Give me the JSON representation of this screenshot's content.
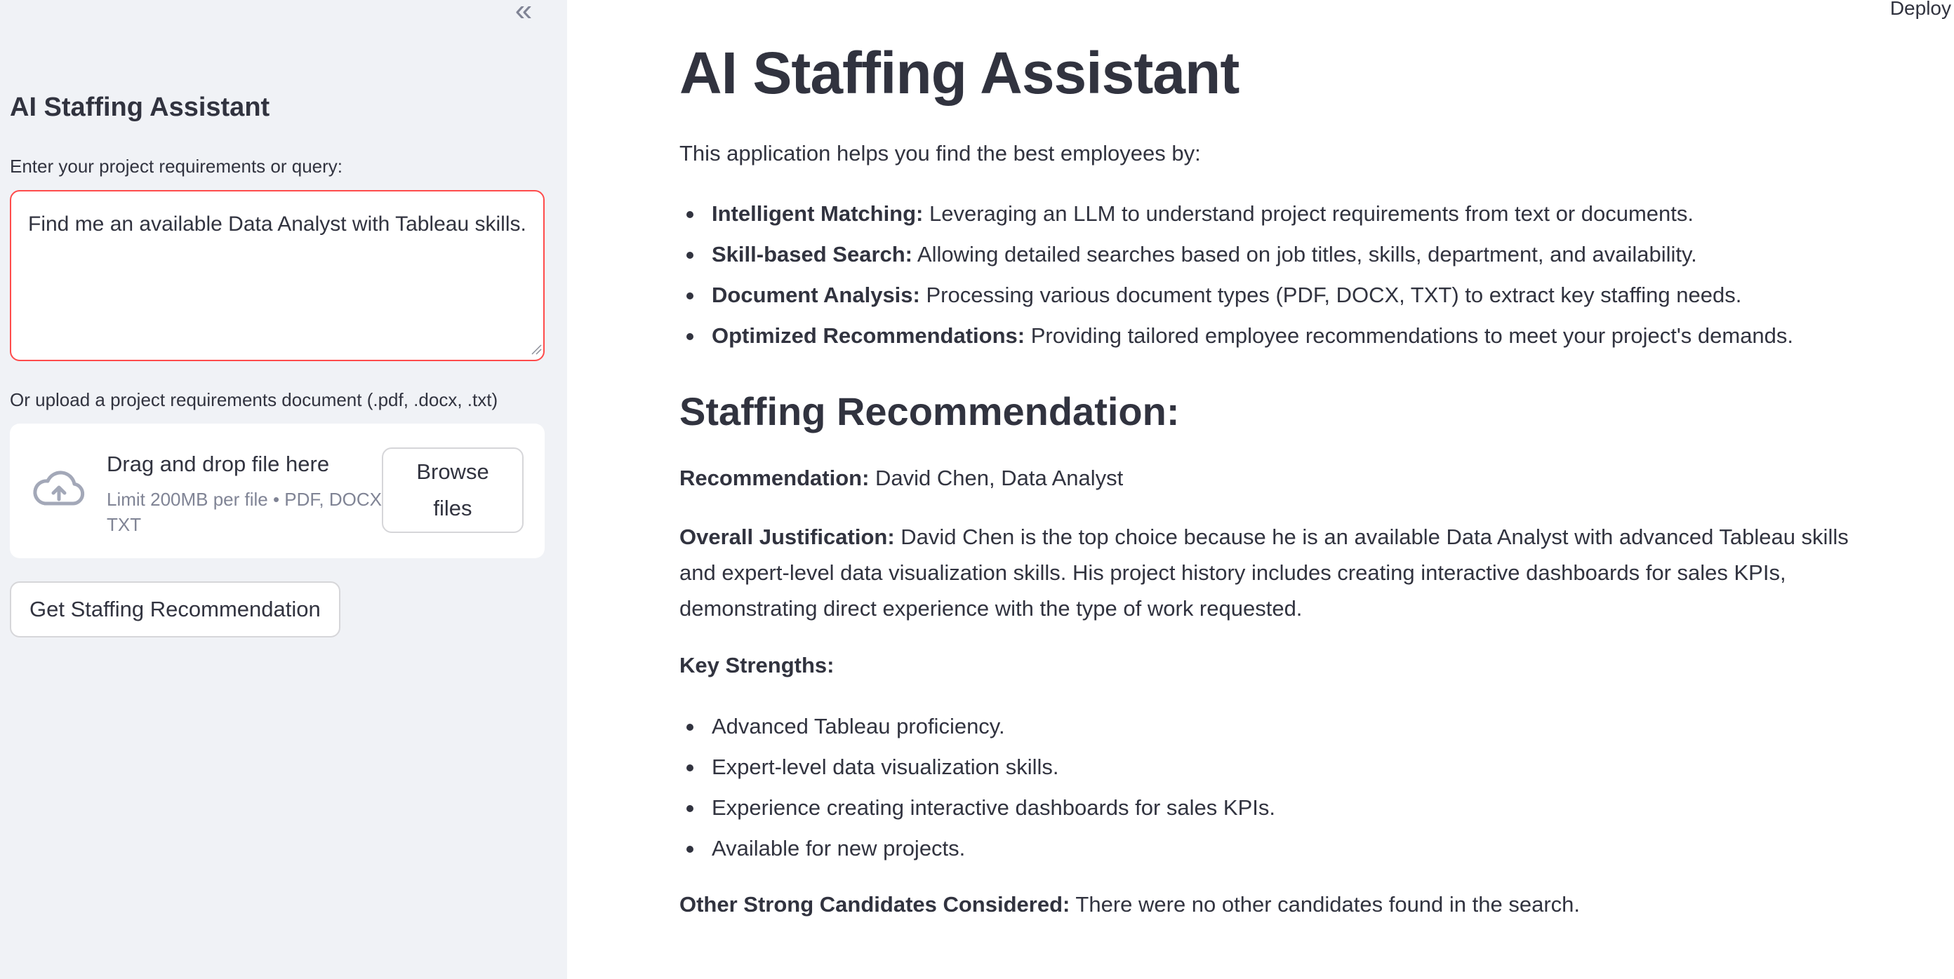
{
  "sidebar": {
    "collapse_glyph": "«",
    "title": "AI Staffing Assistant",
    "query_label": "Enter your project requirements or query:",
    "query_value": "Find me an available Data Analyst with Tableau skills.",
    "upload_label": "Or upload a project requirements document (.pdf, .docx, .txt)",
    "uploader": {
      "drop_text": "Drag and drop file here",
      "limit_text": "Limit 200MB per file • PDF, DOCX, TXT",
      "browse_label": "Browse files",
      "icon": "cloud-upload-icon"
    },
    "submit_label": "Get Staffing Recommendation"
  },
  "header": {
    "deploy_label": "Deploy"
  },
  "main": {
    "title": "AI Staffing Assistant",
    "intro": "This application helps you find the best employees by:",
    "features": [
      {
        "bold": "Intelligent Matching:",
        "text": " Leveraging an LLM to understand project requirements from text or documents."
      },
      {
        "bold": "Skill-based Search:",
        "text": " Allowing detailed searches based on job titles, skills, department, and availability."
      },
      {
        "bold": "Document Analysis:",
        "text": " Processing various document types (PDF, DOCX, TXT) to extract key staffing needs."
      },
      {
        "bold": "Optimized Recommendations:",
        "text": " Providing tailored employee recommendations to meet your project's demands."
      }
    ],
    "result_heading": "Staffing Recommendation:",
    "recommendation": {
      "bold": "Recommendation:",
      "text": " David Chen, Data Analyst"
    },
    "justification": {
      "bold": "Overall Justification:",
      "text": " David Chen is the top choice because he is an available Data Analyst with advanced Tableau skills and expert-level data visualization skills. His project history includes creating interactive dashboards for sales KPIs, demonstrating direct experience with the type of work requested."
    },
    "strengths_label": "Key Strengths:",
    "strengths": [
      "Advanced Tableau proficiency.",
      "Expert-level data visualization skills.",
      "Experience creating interactive dashboards for sales KPIs.",
      "Available for new projects."
    ],
    "others": {
      "bold": "Other Strong Candidates Considered:",
      "text": " There were no other candidates found in the search."
    }
  },
  "colors": {
    "sidebar_bg": "#f0f2f6",
    "text": "#31333f",
    "muted": "#808495",
    "focus_border": "#ff4b4b"
  }
}
